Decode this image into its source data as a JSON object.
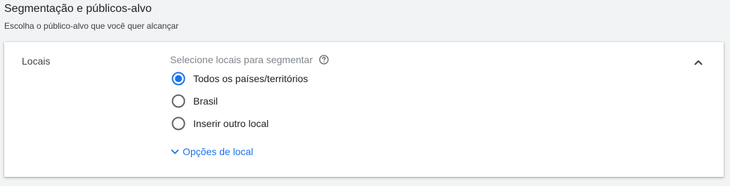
{
  "section": {
    "title": "Segmentação e públicos-alvo",
    "subtitle": "Escolha o público-alvo que você quer alcançar"
  },
  "locations": {
    "label": "Locais",
    "prompt": "Selecione locais para segmentar",
    "help_icon": "help-circle-icon",
    "collapse_icon": "chevron-up-icon",
    "options": [
      {
        "label": "Todos os países/territórios",
        "selected": true
      },
      {
        "label": "Brasil",
        "selected": false
      },
      {
        "label": "Inserir outro local",
        "selected": false
      }
    ],
    "more_options_link": "Opções de local",
    "more_options_icon": "chevron-down-icon"
  },
  "colors": {
    "accent": "#1a73e8",
    "radio_border": "#5f6368",
    "muted_text": "#80868b",
    "card_bg": "#ffffff",
    "page_bg": "#f1f3f4"
  }
}
